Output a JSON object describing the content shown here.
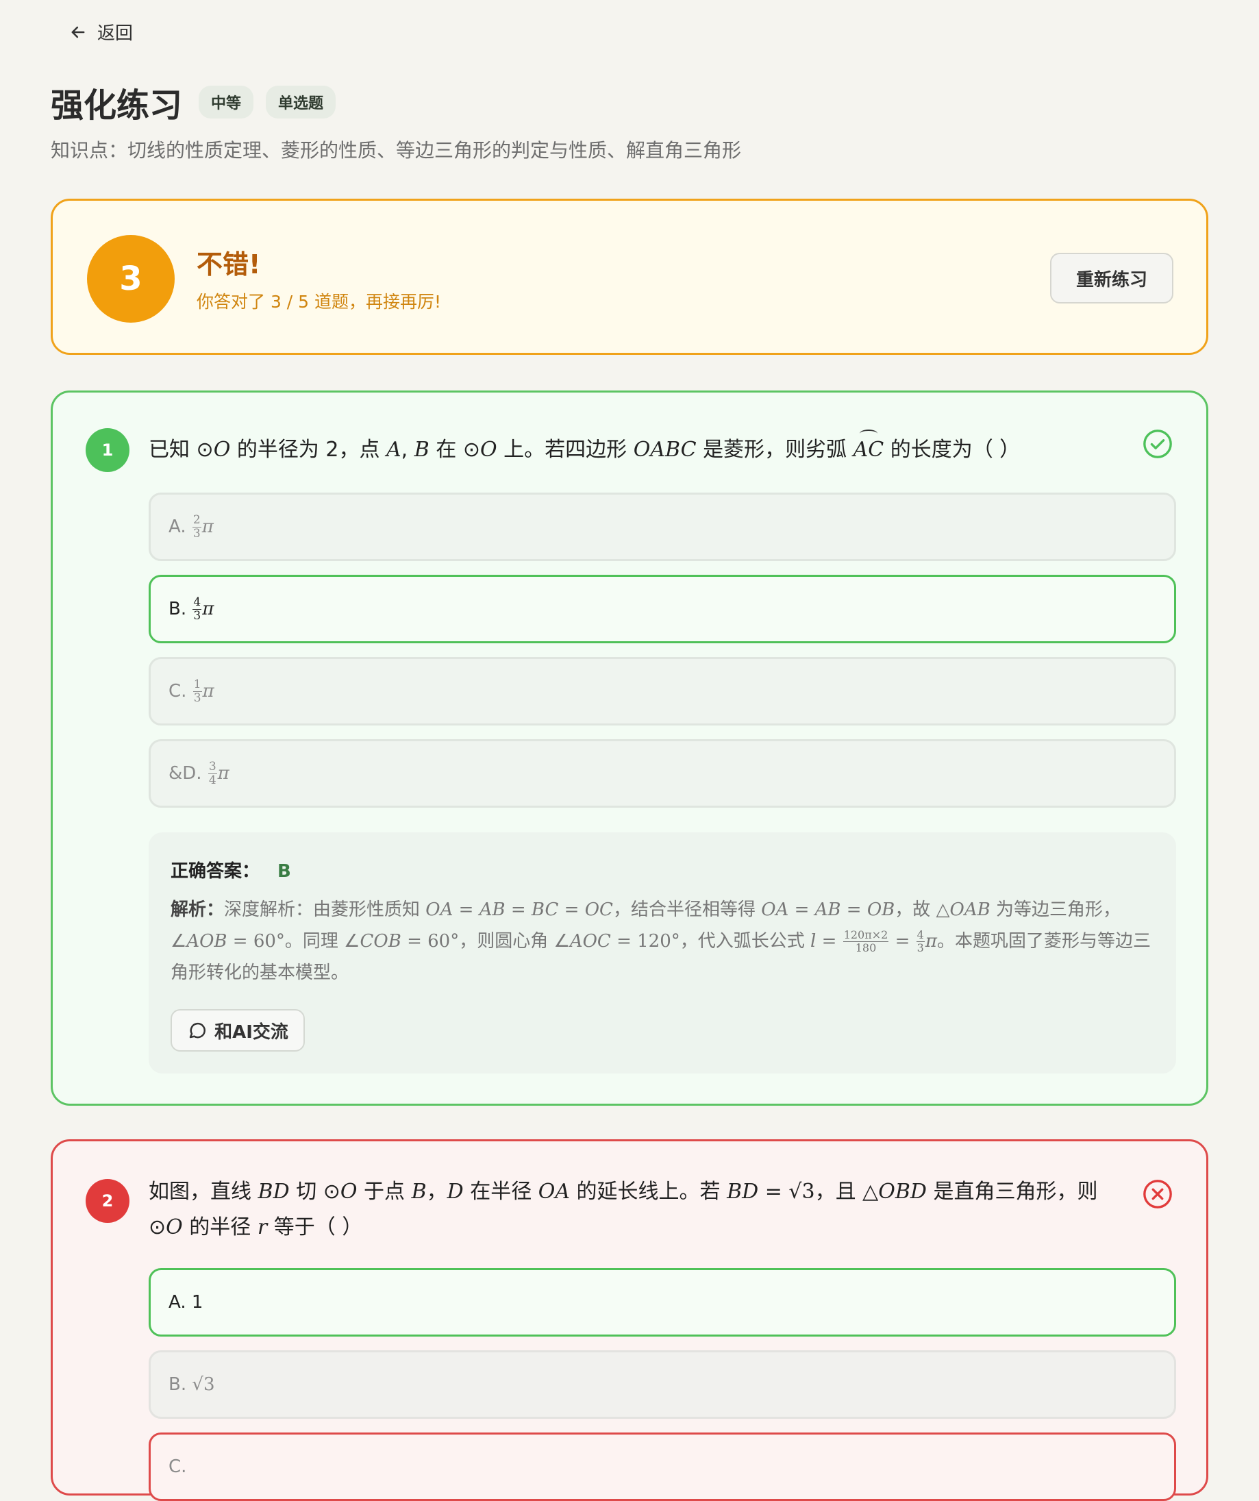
{
  "nav": {
    "back_label": "返回"
  },
  "header": {
    "title": "强化练习",
    "tags": [
      "中等",
      "单选题"
    ],
    "knowledge_points": "知识点：切线的性质定理、菱形的性质、等边三角形的判定与性质、解直角三角形"
  },
  "result": {
    "score": "3",
    "headline": "不错!",
    "summary": "你答对了 3 / 5 道题，再接再厉!",
    "retry_label": "重新练习"
  },
  "questions": [
    {
      "number": "1",
      "status": "correct",
      "status_icon": "check-circle-icon",
      "options": [
        {
          "label": "A.",
          "value": "2/3 π",
          "state": "default"
        },
        {
          "label": "B.",
          "value": "4/3 π",
          "state": "correct"
        },
        {
          "label": "C.",
          "value": "1/3 π",
          "state": "default"
        },
        {
          "label": "&D.",
          "value": "3/4 π",
          "state": "default"
        }
      ],
      "answer_label": "正确答案：",
      "answer_value": "B",
      "analysis_label": "解析：",
      "ai_button_label": "和AI交流"
    },
    {
      "number": "2",
      "status": "wrong",
      "status_icon": "x-circle-icon",
      "options": [
        {
          "label": "A.",
          "value": "1",
          "state": "correct"
        },
        {
          "label": "B.",
          "value": "√3",
          "state": "default"
        },
        {
          "label": "C.",
          "value": "",
          "state": "wrong"
        }
      ]
    }
  ],
  "colors": {
    "background": "#f5f4ef",
    "result_border": "#f0a21a",
    "score_circle": "#f29e0c",
    "correct_green": "#4fc158",
    "wrong_red": "#de4a4a"
  }
}
